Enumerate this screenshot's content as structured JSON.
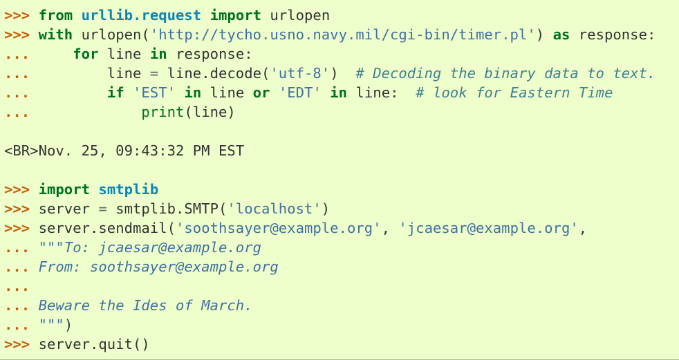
{
  "colors": {
    "background": "#eeffcc",
    "prompt": "#c65d09",
    "keyword": "#007020",
    "module": "#0e84b5",
    "string": "#4070a0",
    "comment": "#408090",
    "text": "#333333"
  },
  "lines": [
    [
      {
        "t": "gp",
        "v": ">>> "
      },
      {
        "t": "k",
        "v": "from"
      },
      {
        "t": "x",
        "v": " "
      },
      {
        "t": "nn",
        "v": "urllib.request"
      },
      {
        "t": "x",
        "v": " "
      },
      {
        "t": "k",
        "v": "import"
      },
      {
        "t": "x",
        "v": " urlopen"
      }
    ],
    [
      {
        "t": "gp",
        "v": ">>> "
      },
      {
        "t": "k",
        "v": "with"
      },
      {
        "t": "x",
        "v": " urlopen("
      },
      {
        "t": "s",
        "v": "'http://tycho.usno.navy.mil/cgi-bin/timer.pl'"
      },
      {
        "t": "x",
        "v": ") "
      },
      {
        "t": "k",
        "v": "as"
      },
      {
        "t": "x",
        "v": " response:"
      }
    ],
    [
      {
        "t": "gp",
        "v": "... "
      },
      {
        "t": "x",
        "v": "    "
      },
      {
        "t": "k",
        "v": "for"
      },
      {
        "t": "x",
        "v": " line "
      },
      {
        "t": "k",
        "v": "in"
      },
      {
        "t": "x",
        "v": " response:"
      }
    ],
    [
      {
        "t": "gp",
        "v": "... "
      },
      {
        "t": "x",
        "v": "        line "
      },
      {
        "t": "o",
        "v": "="
      },
      {
        "t": "x",
        "v": " line.decode("
      },
      {
        "t": "s",
        "v": "'utf-8'"
      },
      {
        "t": "x",
        "v": ")  "
      },
      {
        "t": "c",
        "v": "# Decoding the binary data to text."
      }
    ],
    [
      {
        "t": "gp",
        "v": "... "
      },
      {
        "t": "x",
        "v": "        "
      },
      {
        "t": "k",
        "v": "if"
      },
      {
        "t": "x",
        "v": " "
      },
      {
        "t": "s",
        "v": "'EST'"
      },
      {
        "t": "x",
        "v": " "
      },
      {
        "t": "k",
        "v": "in"
      },
      {
        "t": "x",
        "v": " line "
      },
      {
        "t": "k",
        "v": "or"
      },
      {
        "t": "x",
        "v": " "
      },
      {
        "t": "s",
        "v": "'EDT'"
      },
      {
        "t": "x",
        "v": " "
      },
      {
        "t": "k",
        "v": "in"
      },
      {
        "t": "x",
        "v": " line:  "
      },
      {
        "t": "c",
        "v": "# look for Eastern Time"
      }
    ],
    [
      {
        "t": "gp",
        "v": "... "
      },
      {
        "t": "x",
        "v": "            "
      },
      {
        "t": "nb",
        "v": "print"
      },
      {
        "t": "x",
        "v": "(line)"
      }
    ],
    [],
    [
      {
        "t": "out",
        "v": "<BR>Nov. 25, 09:43:32 PM EST"
      }
    ],
    [],
    [
      {
        "t": "gp",
        "v": ">>> "
      },
      {
        "t": "k",
        "v": "import"
      },
      {
        "t": "x",
        "v": " "
      },
      {
        "t": "nn",
        "v": "smtplib"
      }
    ],
    [
      {
        "t": "gp",
        "v": ">>> "
      },
      {
        "t": "x",
        "v": "server "
      },
      {
        "t": "o",
        "v": "="
      },
      {
        "t": "x",
        "v": " smtplib.SMTP("
      },
      {
        "t": "s",
        "v": "'localhost'"
      },
      {
        "t": "x",
        "v": ")"
      }
    ],
    [
      {
        "t": "gp",
        "v": ">>> "
      },
      {
        "t": "x",
        "v": "server.sendmail("
      },
      {
        "t": "s",
        "v": "'soothsayer@example.org'"
      },
      {
        "t": "x",
        "v": ", "
      },
      {
        "t": "s",
        "v": "'jcaesar@example.org'"
      },
      {
        "t": "x",
        "v": ","
      }
    ],
    [
      {
        "t": "gp",
        "v": "... "
      },
      {
        "t": "s",
        "v": "\"\"\""
      },
      {
        "t": "sd",
        "v": "To: jcaesar@example.org"
      }
    ],
    [
      {
        "t": "gp",
        "v": "... "
      },
      {
        "t": "sd",
        "v": "From: soothsayer@example.org"
      }
    ],
    [
      {
        "t": "gp",
        "v": "..."
      }
    ],
    [
      {
        "t": "gp",
        "v": "... "
      },
      {
        "t": "sd",
        "v": "Beware the Ides of March."
      }
    ],
    [
      {
        "t": "gp",
        "v": "... "
      },
      {
        "t": "s",
        "v": "\"\"\""
      },
      {
        "t": "x",
        "v": ")"
      }
    ],
    [
      {
        "t": "gp",
        "v": ">>> "
      },
      {
        "t": "x",
        "v": "server.quit()"
      }
    ]
  ]
}
